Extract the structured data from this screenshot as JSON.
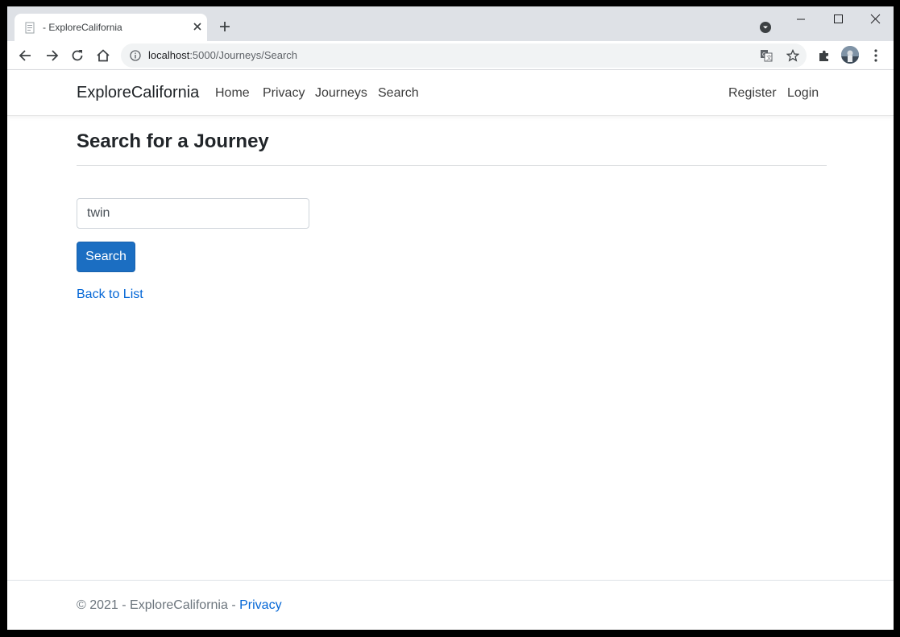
{
  "browser": {
    "tab_title": " - ExploreCalifornia",
    "url_host": "localhost",
    "url_path": ":5000/Journeys/Search"
  },
  "site": {
    "brand": "ExploreCalifornia",
    "nav": {
      "home": "Home",
      "privacy": "Privacy",
      "journeys": "Journeys",
      "search": "Search",
      "register": "Register",
      "login": "Login"
    }
  },
  "main": {
    "heading": "Search for a Journey",
    "search_value": "twin",
    "search_button": "Search",
    "back_link": "Back to List"
  },
  "footer": {
    "text": "© 2021 - ExploreCalifornia - ",
    "privacy_link": "Privacy"
  },
  "colors": {
    "primary_button": "#1b6ec2",
    "link": "#0366d6"
  }
}
